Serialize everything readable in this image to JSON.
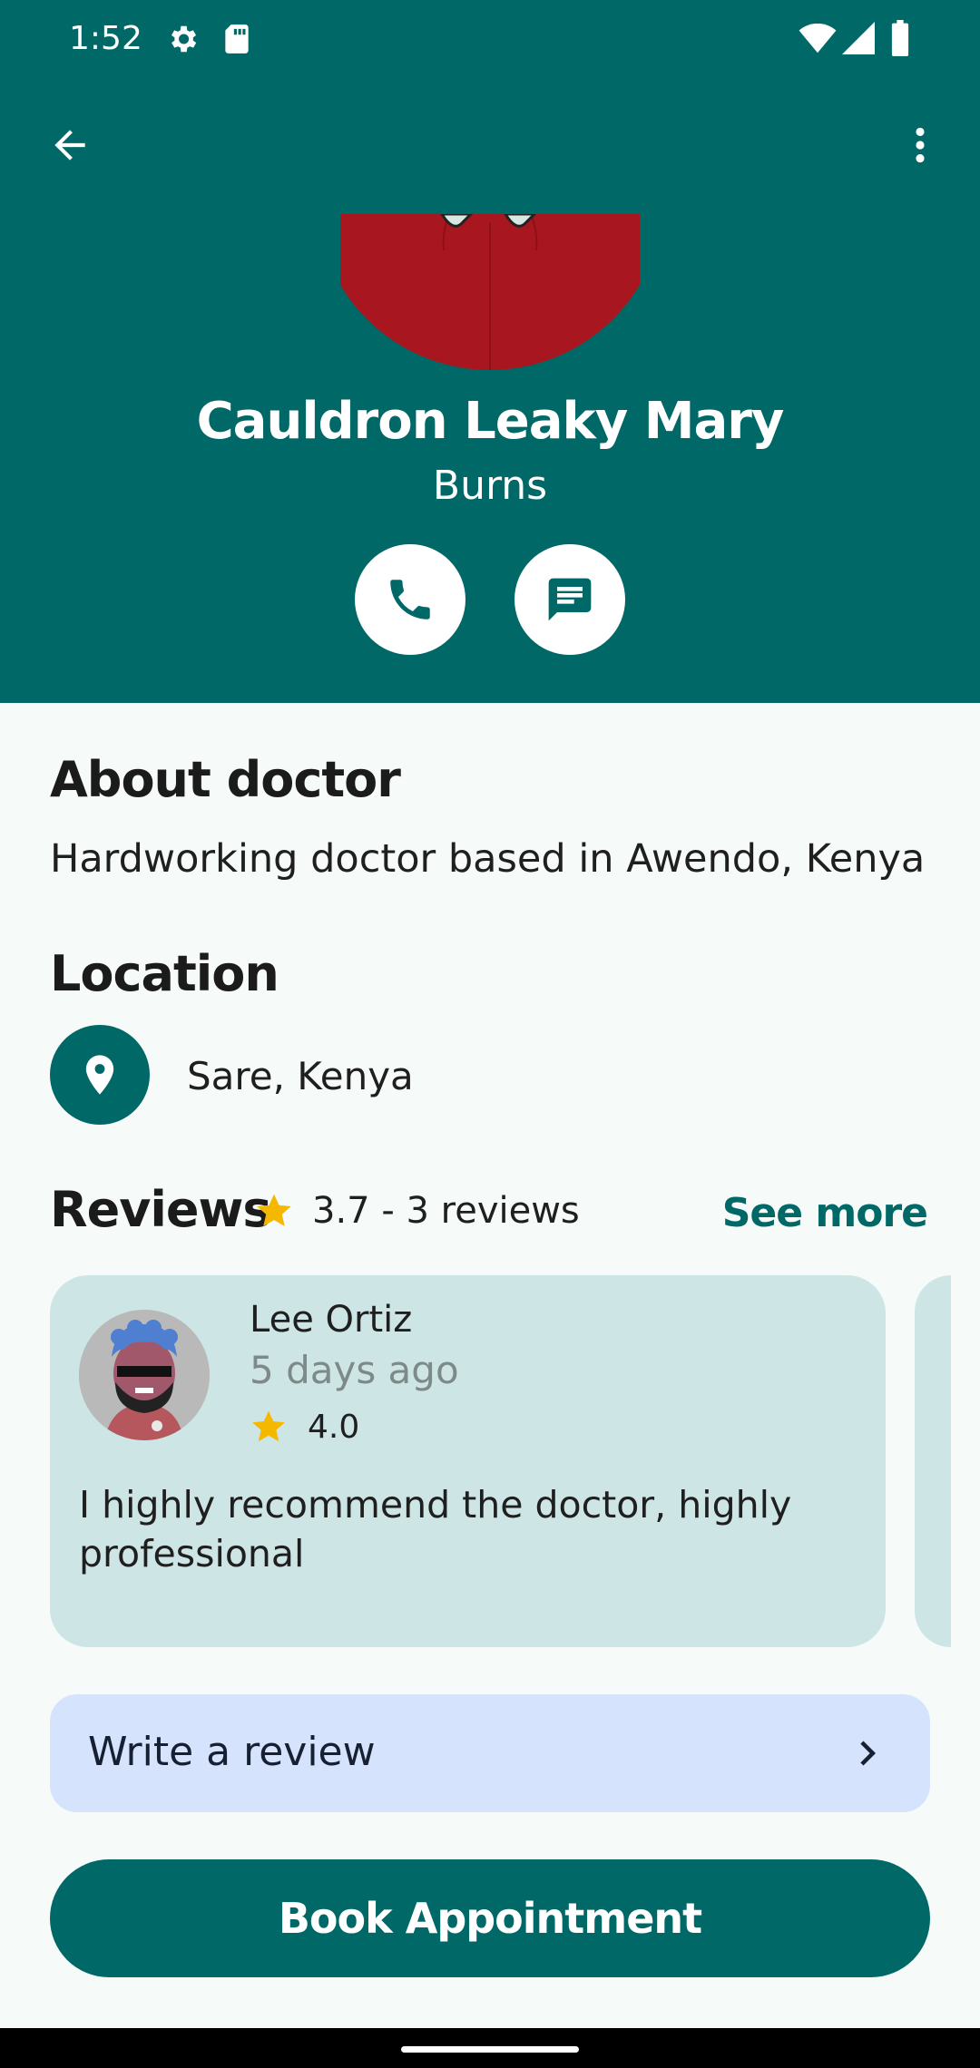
{
  "status_bar": {
    "time": "1:52",
    "icons": [
      "gear-icon",
      "sd-card-icon",
      "wifi-icon",
      "signal-icon",
      "battery-icon"
    ]
  },
  "app_bar": {
    "back_icon": "arrow-back-icon",
    "menu_icon": "more-vert-icon"
  },
  "doctor": {
    "name": "Cauldron Leaky Mary",
    "specialty": "Burns"
  },
  "actions": {
    "call_icon": "phone-icon",
    "message_icon": "chat-icon"
  },
  "about": {
    "title": "About doctor",
    "text": "Hardworking doctor based in Awendo, Kenya"
  },
  "location": {
    "title": "Location",
    "text": "Sare, Kenya",
    "icon": "location-pin-icon"
  },
  "reviews": {
    "title": "Reviews",
    "summary": "3.7 - 3 reviews",
    "see_more": "See more",
    "items": [
      {
        "name": "Lee Ortiz",
        "date": "5 days ago",
        "rating": "4.0",
        "text": "I highly recommend the doctor, highly professional"
      }
    ]
  },
  "write_review": {
    "label": "Write a review"
  },
  "book": {
    "label": "Book Appointment"
  },
  "colors": {
    "primary": "#006866",
    "card": "#CDE6E5",
    "write_review_bg": "#D5E3FC",
    "star": "#F5B800",
    "background": "#F6FAF9"
  }
}
